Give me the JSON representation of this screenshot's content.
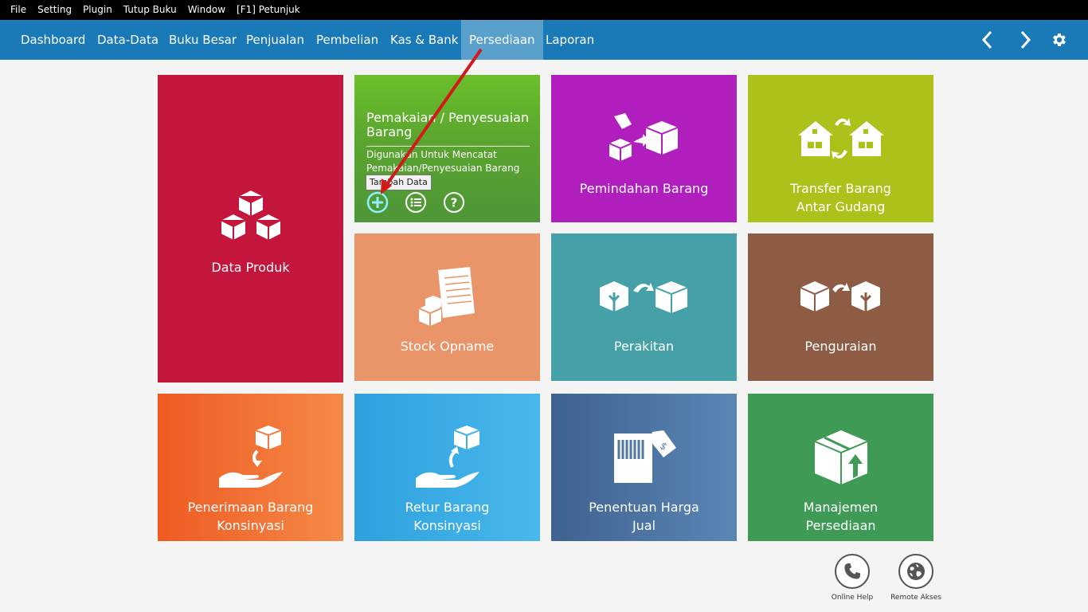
{
  "menubar": [
    "File",
    "Setting",
    "Plugin",
    "Tutup Buku",
    "Window",
    "[F1] Petunjuk"
  ],
  "nav": {
    "items": [
      "Dashboard",
      "Data-Data",
      "Buku Besar",
      "Penjualan",
      "Pembelian",
      "Kas & Bank",
      "Persediaan",
      "Laporan"
    ],
    "active": "Persediaan"
  },
  "tiles": {
    "produk": "Data Produk",
    "pemakaian": {
      "title": "Pemakaian / Penyesuaian Barang",
      "desc": "Digunakan Untuk Mencatat Pemakaian/Penyesuaian Barang"
    },
    "pemindahan": "Pemindahan Barang",
    "transfer": [
      "Transfer Barang",
      "Antar Gudang"
    ],
    "opname": "Stock Opname",
    "perakitan": "Perakitan",
    "penguraian": "Penguraian",
    "penerimaan": [
      "Penerimaan Barang",
      "Konsinyasi"
    ],
    "retur": [
      "Retur Barang",
      "Konsinyasi"
    ],
    "harga": [
      "Penentuan Harga",
      "Jual"
    ],
    "manajemen": [
      "Manajemen",
      "Persediaan"
    ]
  },
  "tooltip": "Tambah Data",
  "bottom": {
    "online_help": "Online Help",
    "remote": "Remote Akses"
  },
  "colors": {
    "nav": "#1a7ab8",
    "accent_arrow": "#d11a1a"
  },
  "icons": [
    "chevron-left-icon",
    "chevron-right-icon",
    "gear-icon",
    "plus-circle-icon",
    "list-circle-icon",
    "help-circle-icon",
    "phone-icon",
    "globe-icon"
  ]
}
